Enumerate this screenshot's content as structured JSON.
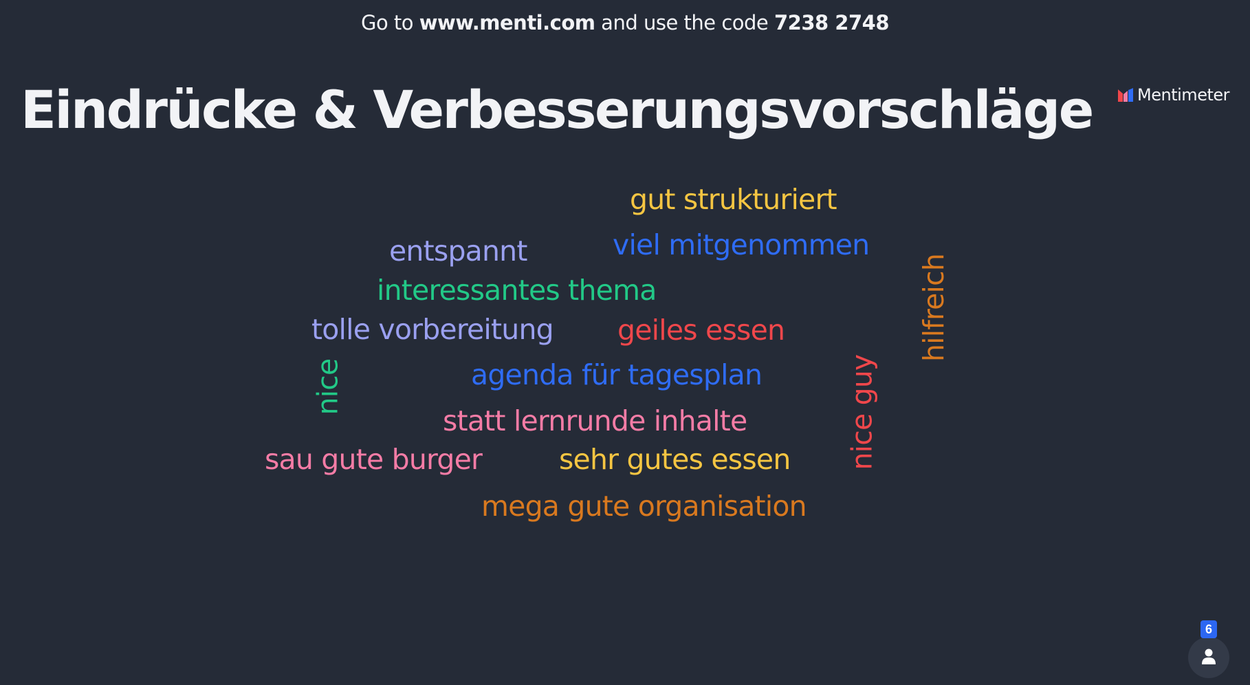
{
  "join": {
    "prefix": "Go to ",
    "url": "www.menti.com",
    "middle": " and use the code ",
    "code": "7238 2748"
  },
  "title": "Eindrücke & Verbesserungsvorschläge",
  "brand": {
    "name": "Mentimeter",
    "icon": "mentimeter-logo-icon"
  },
  "word_cloud": [
    {
      "text": "gut strukturiert",
      "color": "#f5c542"
    },
    {
      "text": "viel mitgenommen",
      "color": "#2f6cf5"
    },
    {
      "text": "entspannt",
      "color": "#9aa0f0"
    },
    {
      "text": "interessantes thema",
      "color": "#22c987"
    },
    {
      "text": "tolle vorbereitung",
      "color": "#9aa0f0"
    },
    {
      "text": "geiles essen",
      "color": "#f0474b"
    },
    {
      "text": "agenda für tagesplan",
      "color": "#2f6cf5"
    },
    {
      "text": "statt lernrunde inhalte",
      "color": "#f57ca6"
    },
    {
      "text": "sau gute burger",
      "color": "#f57ca6"
    },
    {
      "text": "sehr gutes essen",
      "color": "#f5c542"
    },
    {
      "text": "mega gute organisation",
      "color": "#d9791f"
    },
    {
      "text": "nice",
      "color": "#22c987"
    },
    {
      "text": "nice guy",
      "color": "#f0474b"
    },
    {
      "text": "hilfreich",
      "color": "#d9791f"
    }
  ],
  "participants": {
    "count": "6",
    "icon": "person-icon"
  }
}
